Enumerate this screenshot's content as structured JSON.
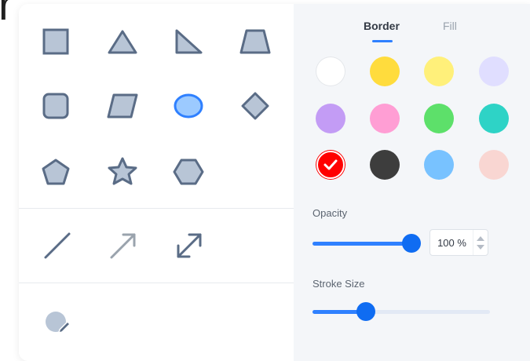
{
  "background_text": "r",
  "shapes": {
    "row1": [
      "square-icon",
      "triangle-icon",
      "right-triangle-icon",
      "trapezoid-icon"
    ],
    "row2": [
      "rounded-square-icon",
      "parallelogram-icon",
      "ellipse-icon",
      "diamond-icon"
    ],
    "row3": [
      "pentagon-icon",
      "star-icon",
      "hexagon-icon"
    ],
    "lines": [
      "line-icon",
      "arrow-icon",
      "double-arrow-icon"
    ],
    "extra": [
      "pen-fill-icon"
    ],
    "selected": "ellipse-icon",
    "shape_fill": "#b8c5d6",
    "shape_stroke": "#5a6c86",
    "selected_fill": "#9ccaff",
    "selected_stroke": "#2f80ff"
  },
  "tabs": {
    "border_label": "Border",
    "fill_label": "Fill",
    "active": "Border"
  },
  "colors": [
    "#ffffff",
    "#ffdc3d",
    "#fff07a",
    "#e0deff",
    "#c39cf5",
    "#ff9ed4",
    "#5de06a",
    "#2ed3c6",
    "#ff0000",
    "#3d3d3d",
    "#78c2ff",
    "#f9d6d2"
  ],
  "selected_color": "#ff0000",
  "opacity": {
    "label": "Opacity",
    "value_text": "100 %",
    "value_fraction": 1.0
  },
  "stroke": {
    "label": "Stroke Size",
    "value_fraction": 0.3
  },
  "accent_color": "#2f80ff"
}
